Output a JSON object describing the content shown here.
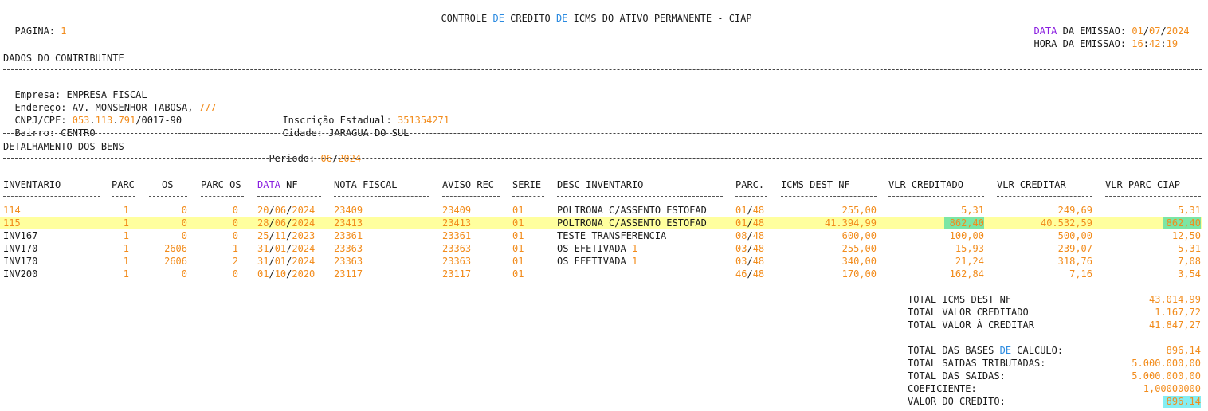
{
  "header": {
    "title_parts": [
      "CONTROLE",
      "DE",
      "CREDITO",
      "DE",
      "ICMS DO ATIVO PERMANENTE - CIAP"
    ],
    "page_label": "PAGINA:",
    "page_value": "1",
    "emission_date_label_a": "DATA",
    "emission_date_label_b": "DA EMISSAO:",
    "emission_date_d": "01",
    "emission_date_m": "07",
    "emission_date_y": "2024",
    "emission_time_label": "HORA DA EMISSAO:",
    "emission_time_h": "16",
    "emission_time_m": "42",
    "emission_time_s": "19"
  },
  "contributor": {
    "section_title": "DADOS DO CONTRIBUINTE",
    "empresa_label": "Empresa:",
    "empresa_value": "EMPRESA FISCAL",
    "endereco_label": "Endereço:",
    "endereco_value": "AV. MONSENHOR TABOSA,",
    "endereco_number": "777",
    "cnpj_label": "CNPJ/CPF:",
    "cnpj_a": "053",
    "cnpj_b": "113",
    "cnpj_c": "791",
    "cnpj_d": "0017-90",
    "ie_label": "Inscrição Estadual:",
    "ie_value": "351354271",
    "bairro_label": "Bairro:",
    "bairro_value": "CENTRO",
    "cidade_label": "Cidade:",
    "cidade_value": "JARAGUA DO SUL"
  },
  "detail": {
    "section_title": "DETALHAMENTO DOS BENS",
    "periodo_label": "Periodo:",
    "periodo_m": "06",
    "periodo_y": "2024"
  },
  "table": {
    "headers": {
      "inventario": "INVENTARIO",
      "parc": "PARC",
      "os": "OS",
      "parc_os": "PARC OS",
      "data_a": "DATA",
      "data_b": "NF",
      "nota_fiscal": "NOTA FISCAL",
      "aviso_rec": "AVISO REC",
      "serie": "SERIE",
      "desc_inventario": "DESC INVENTARIO",
      "parc2": "PARC.",
      "icms_dest_nf": "ICMS DEST NF",
      "vlr_creditado": "VLR CREDITADO",
      "vlr_creditar": "VLR CREDITAR",
      "vlr_parc_ciap": "VLR PARC CIAP"
    },
    "rows": [
      {
        "inventario": "114",
        "parc": "1",
        "os": "0",
        "parc_os": "0",
        "data": "20/06/2024",
        "nota_fiscal": "23409",
        "aviso_rec": "23409",
        "serie": "01",
        "desc": "POLTRONA C/ASSENTO ESTOFAD",
        "desc_num": "",
        "parc2_a": "01",
        "parc2_b": "48",
        "icms": "255,00",
        "creditado": "5,31",
        "creditar": "249,69",
        "parc_ciap": "5,31"
      },
      {
        "inventario": "115",
        "parc": "1",
        "os": "0",
        "parc_os": "0",
        "data": "28/06/2024",
        "nota_fiscal": "23413",
        "aviso_rec": "23413",
        "serie": "01",
        "desc": "POLTRONA C/ASSENTO ESTOFAD",
        "desc_num": "",
        "parc2_a": "01",
        "parc2_b": "48",
        "icms": "41.394,99",
        "creditado": "862,40",
        "creditar": "40.532,59",
        "parc_ciap": "862,40"
      },
      {
        "inventario": "INV167",
        "parc": "1",
        "os": "0",
        "parc_os": "0",
        "data": "25/11/2023",
        "nota_fiscal": "23361",
        "aviso_rec": "23361",
        "serie": "01",
        "desc": "TESTE TRANSFERENCIA",
        "desc_num": "",
        "parc2_a": "08",
        "parc2_b": "48",
        "icms": "600,00",
        "creditado": "100,00",
        "creditar": "500,00",
        "parc_ciap": "12,50"
      },
      {
        "inventario": "INV170",
        "parc": "1",
        "os": "2606",
        "parc_os": "1",
        "data": "31/01/2024",
        "nota_fiscal": "23363",
        "aviso_rec": "23363",
        "serie": "01",
        "desc": "OS EFETIVADA",
        "desc_num": "1",
        "parc2_a": "03",
        "parc2_b": "48",
        "icms": "255,00",
        "creditado": "15,93",
        "creditar": "239,07",
        "parc_ciap": "5,31"
      },
      {
        "inventario": "INV170",
        "parc": "1",
        "os": "2606",
        "parc_os": "2",
        "data": "31/01/2024",
        "nota_fiscal": "23363",
        "aviso_rec": "23363",
        "serie": "01",
        "desc": "OS EFETIVADA",
        "desc_num": "1",
        "parc2_a": "03",
        "parc2_b": "48",
        "icms": "340,00",
        "creditado": "21,24",
        "creditar": "318,76",
        "parc_ciap": "7,08"
      },
      {
        "inventario": "INV200",
        "parc": "1",
        "os": "0",
        "parc_os": "0",
        "data": "01/10/2020",
        "nota_fiscal": "23117",
        "aviso_rec": "23117",
        "serie": "01",
        "desc": "",
        "desc_num": "",
        "parc2_a": "46",
        "parc2_b": "48",
        "icms": "170,00",
        "creditado": "162,84",
        "creditar": "7,16",
        "parc_ciap": "3,54"
      }
    ]
  },
  "totals": {
    "total_icms_label": "TOTAL ICMS DEST NF",
    "total_icms_value": "43.014,99",
    "total_creditado_label": "TOTAL VALOR CREDITADO",
    "total_creditado_value": "1.167,72",
    "total_creditar_label": "TOTAL VALOR À CREDITAR",
    "total_creditar_value": "41.847,27",
    "bases_label_a": "TOTAL DAS BASES",
    "bases_label_b": "DE",
    "bases_label_c": "CALCULO:",
    "bases_value": "896,14",
    "saidas_trib_label": "TOTAL SAIDAS TRIBUTADAS:",
    "saidas_trib_value": "5.000.000,00",
    "saidas_label": "TOTAL DAS SAIDAS:",
    "saidas_value": "5.000.000,00",
    "coef_label": "COEFICIENTE:",
    "coef_value": "1,00000000",
    "valor_credito_label": "VALOR DO CREDITO:",
    "valor_credito_value": "896,14"
  },
  "colors": {
    "number": "#f28c1c",
    "keyword_blue": "#2a8ae0",
    "keyword_purple": "#8a1ee0",
    "highlight_row": "#ffff9e",
    "highlight_green": "#7ce6a4",
    "highlight_cyan": "#84eef2"
  }
}
